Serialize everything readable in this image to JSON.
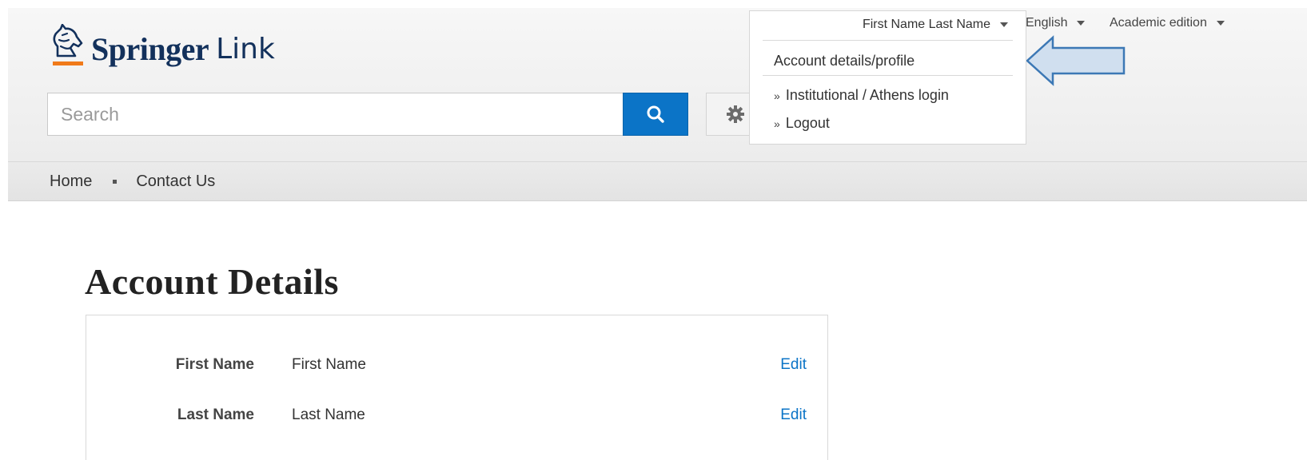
{
  "header": {
    "logo": {
      "brand": "Springer",
      "product": "Link"
    },
    "search": {
      "placeholder": "Search"
    },
    "utilities": {
      "user_name": "First Name Last Name",
      "language": "English",
      "edition": "Academic edition"
    },
    "user_menu": {
      "items": [
        {
          "label": "Account details/profile"
        },
        {
          "prefix": "»",
          "label": "Institutional / Athens login"
        },
        {
          "prefix": "»",
          "label": "Logout"
        }
      ]
    }
  },
  "nav": {
    "items": [
      {
        "label": "Home"
      },
      {
        "label": "Contact Us"
      }
    ]
  },
  "main": {
    "title": "Account Details",
    "fields": [
      {
        "label": "First Name",
        "value": "First Name",
        "action": "Edit"
      },
      {
        "label": "Last Name",
        "value": "Last Name",
        "action": "Edit"
      }
    ]
  },
  "icons": {
    "logo": "horse-head-icon",
    "search": "search-icon",
    "settings": "gear-icon",
    "dropdown": "caret-down-icon",
    "pointer": "arrow-left-icon"
  },
  "colors": {
    "brand_navy": "#13315c",
    "logo_underline": "#f07a1a",
    "accent_blue": "#0b74c7",
    "arrow_fill": "#d0dfef",
    "arrow_stroke": "#3c78b5"
  }
}
